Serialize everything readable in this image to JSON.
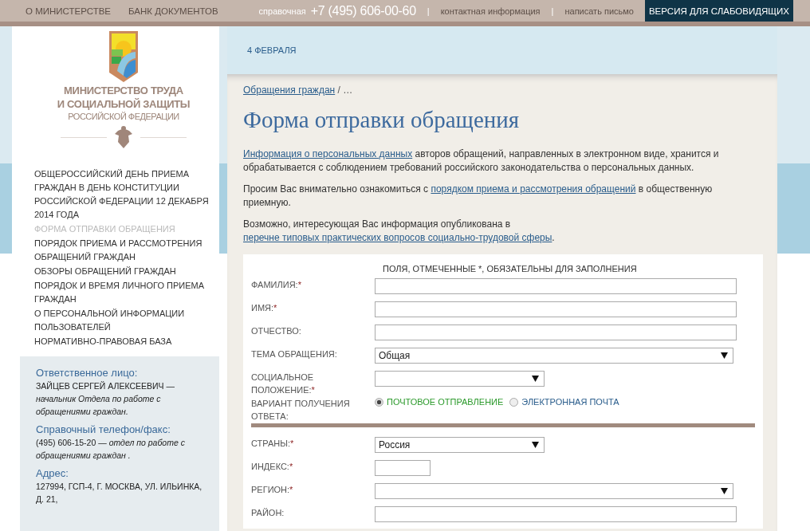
{
  "top_bar": {
    "items": [
      {
        "kind": "link",
        "text": "О МИНИСТЕРСТВЕ"
      },
      {
        "kind": "link",
        "text": "БАНК ДОКУМЕНТОВ"
      },
      {
        "kind": "spacer"
      },
      {
        "kind": "label",
        "text": "справочная"
      },
      {
        "kind": "phone",
        "text": "+7 (495) 606-00-60"
      },
      {
        "kind": "separator",
        "text": "|"
      },
      {
        "kind": "link-small",
        "text": "контактная информация"
      },
      {
        "kind": "separator",
        "text": "|"
      },
      {
        "kind": "link-small",
        "text": "написать письмо"
      },
      {
        "kind": "button",
        "text": "ВЕРСИЯ ДЛЯ СЛАБОВИДЯЩИХ"
      }
    ]
  },
  "logo": {
    "lines": [
      "МИНИСТЕРСТВО ТРУДА",
      "И СОЦИАЛЬНОЙ ЗАЩИТЫ"
    ],
    "subtitle": "РОССИЙСКОЙ ФЕДЕРАЦИИ"
  },
  "sidebar": {
    "items": [
      {
        "label": "ОБЩЕРОССИЙСКИЙ ДЕНЬ ПРИЕМА ГРАЖДАН В ДЕНЬ КОНСТИТУЦИИ РОССИЙСКОЙ ФЕДЕРАЦИИ 12 ДЕКАБРЯ 2014 ГОДА",
        "selected": false
      },
      {
        "label": "ФОРМА ОТПРАВКИ ОБРАЩЕНИЯ",
        "selected": true
      },
      {
        "label": "ПОРЯДОК ПРИЕМА И РАССМОТРЕНИЯ ОБРАЩЕНИЙ ГРАЖДАН",
        "selected": false
      },
      {
        "label": "ОБЗОРЫ ОБРАЩЕНИЙ ГРАЖДАН",
        "selected": false
      },
      {
        "label": "ПОРЯДОК И ВРЕМЯ ЛИЧНОГО ПРИЕМА ГРАЖДАН",
        "selected": false
      },
      {
        "label": "О ПЕРСОНАЛЬНОЙ ИНФОРМАЦИИ ПОЛЬЗОВАТЕЛЕЙ",
        "selected": false
      },
      {
        "label": "НОРМАТИВНО-ПРАВОВАЯ БАЗА",
        "selected": false
      }
    ]
  },
  "contacts": [
    {
      "heading": "Ответственное лицо:",
      "text": "ЗАЙЦЕВ СЕРГЕЙ АЛЕКСЕЕВИЧ — *начальник Отдела по работе с обращениями граждан.*"
    },
    {
      "heading": "Справочный телефон/факс:",
      "text": "(495) 606-15-20 — *отдел по работе с обращениями граждан .*"
    },
    {
      "heading": "Адрес:",
      "text": "127994, ГСП-4, Г. МОСКВА, УЛ. ИЛЬИНКА, Д. 21,"
    }
  ],
  "date": "4 ФЕВРАЛЯ",
  "breadcrumb": {
    "link": "Обращения граждан",
    "rest": "/ …"
  },
  "title": "Форма отправки обращения",
  "paragraphs": [
    [
      {
        "kind": "link",
        "text": "Информация о персональных данных"
      },
      {
        "kind": "text",
        "text": " авторов обращений, направленных в электронном виде, хранится и обрабатывается с соблюдением требований российского законодательства о персональных данных."
      }
    ],
    [
      {
        "kind": "text",
        "text": "Просим Вас внимательно ознакомиться с "
      },
      {
        "kind": "link",
        "text": "порядком приема и рассмотрения обращений"
      },
      {
        "kind": "text",
        "text": " в общественную приемную."
      }
    ],
    [
      {
        "kind": "text",
        "text": "Возможно, интересующая Вас информация опубликована в "
      },
      {
        "kind": "link",
        "text": "перечне типовых практических вопросов социально-трудовой сферы"
      },
      {
        "kind": "text",
        "text": "."
      }
    ]
  ],
  "form": {
    "note": "ПОЛЯ, ОТМЕЧЕННЫЕ *, ОБЯЗАТЕЛЬНЫ ДЛЯ ЗАПОЛНЕНИЯ",
    "rows": [
      {
        "kind": "text",
        "label": "ФАМИЛИЯ:",
        "mark": "*"
      },
      {
        "kind": "text",
        "label": "ИМЯ:",
        "mark": "*"
      },
      {
        "kind": "text",
        "label": "ОТЧЕСТВО:"
      },
      {
        "kind": "select",
        "label": "ТЕМА ОБРАЩЕНИЯ:",
        "value": "Общая"
      },
      {
        "kind": "choice",
        "label": "СОЦИАЛЬНОЕ ПОЛОЖЕНИЕ:",
        "mark": "*"
      },
      {
        "kind": "radio",
        "label": "ВАРИАНТ ПОЛУЧЕНИЯ ОТВЕТА:",
        "options": [
          {
            "label": "ПОЧТОВОЕ ОТПРАВЛЕНИЕ",
            "selected": true
          },
          {
            "label": "ЭЛЕКТРОННАЯ ПОЧТА",
            "selected": false
          }
        ]
      },
      {
        "kind": "divider"
      },
      {
        "kind": "choice",
        "label": "СТРАНЫ:",
        "mark": "*",
        "value": "Россия"
      },
      {
        "kind": "code",
        "label": "ИНДЕКС:",
        "mark": "*"
      },
      {
        "kind": "select",
        "label": "РЕГИОН:",
        "mark": "*"
      },
      {
        "kind": "text",
        "label": "РАЙОН:"
      }
    ]
  }
}
